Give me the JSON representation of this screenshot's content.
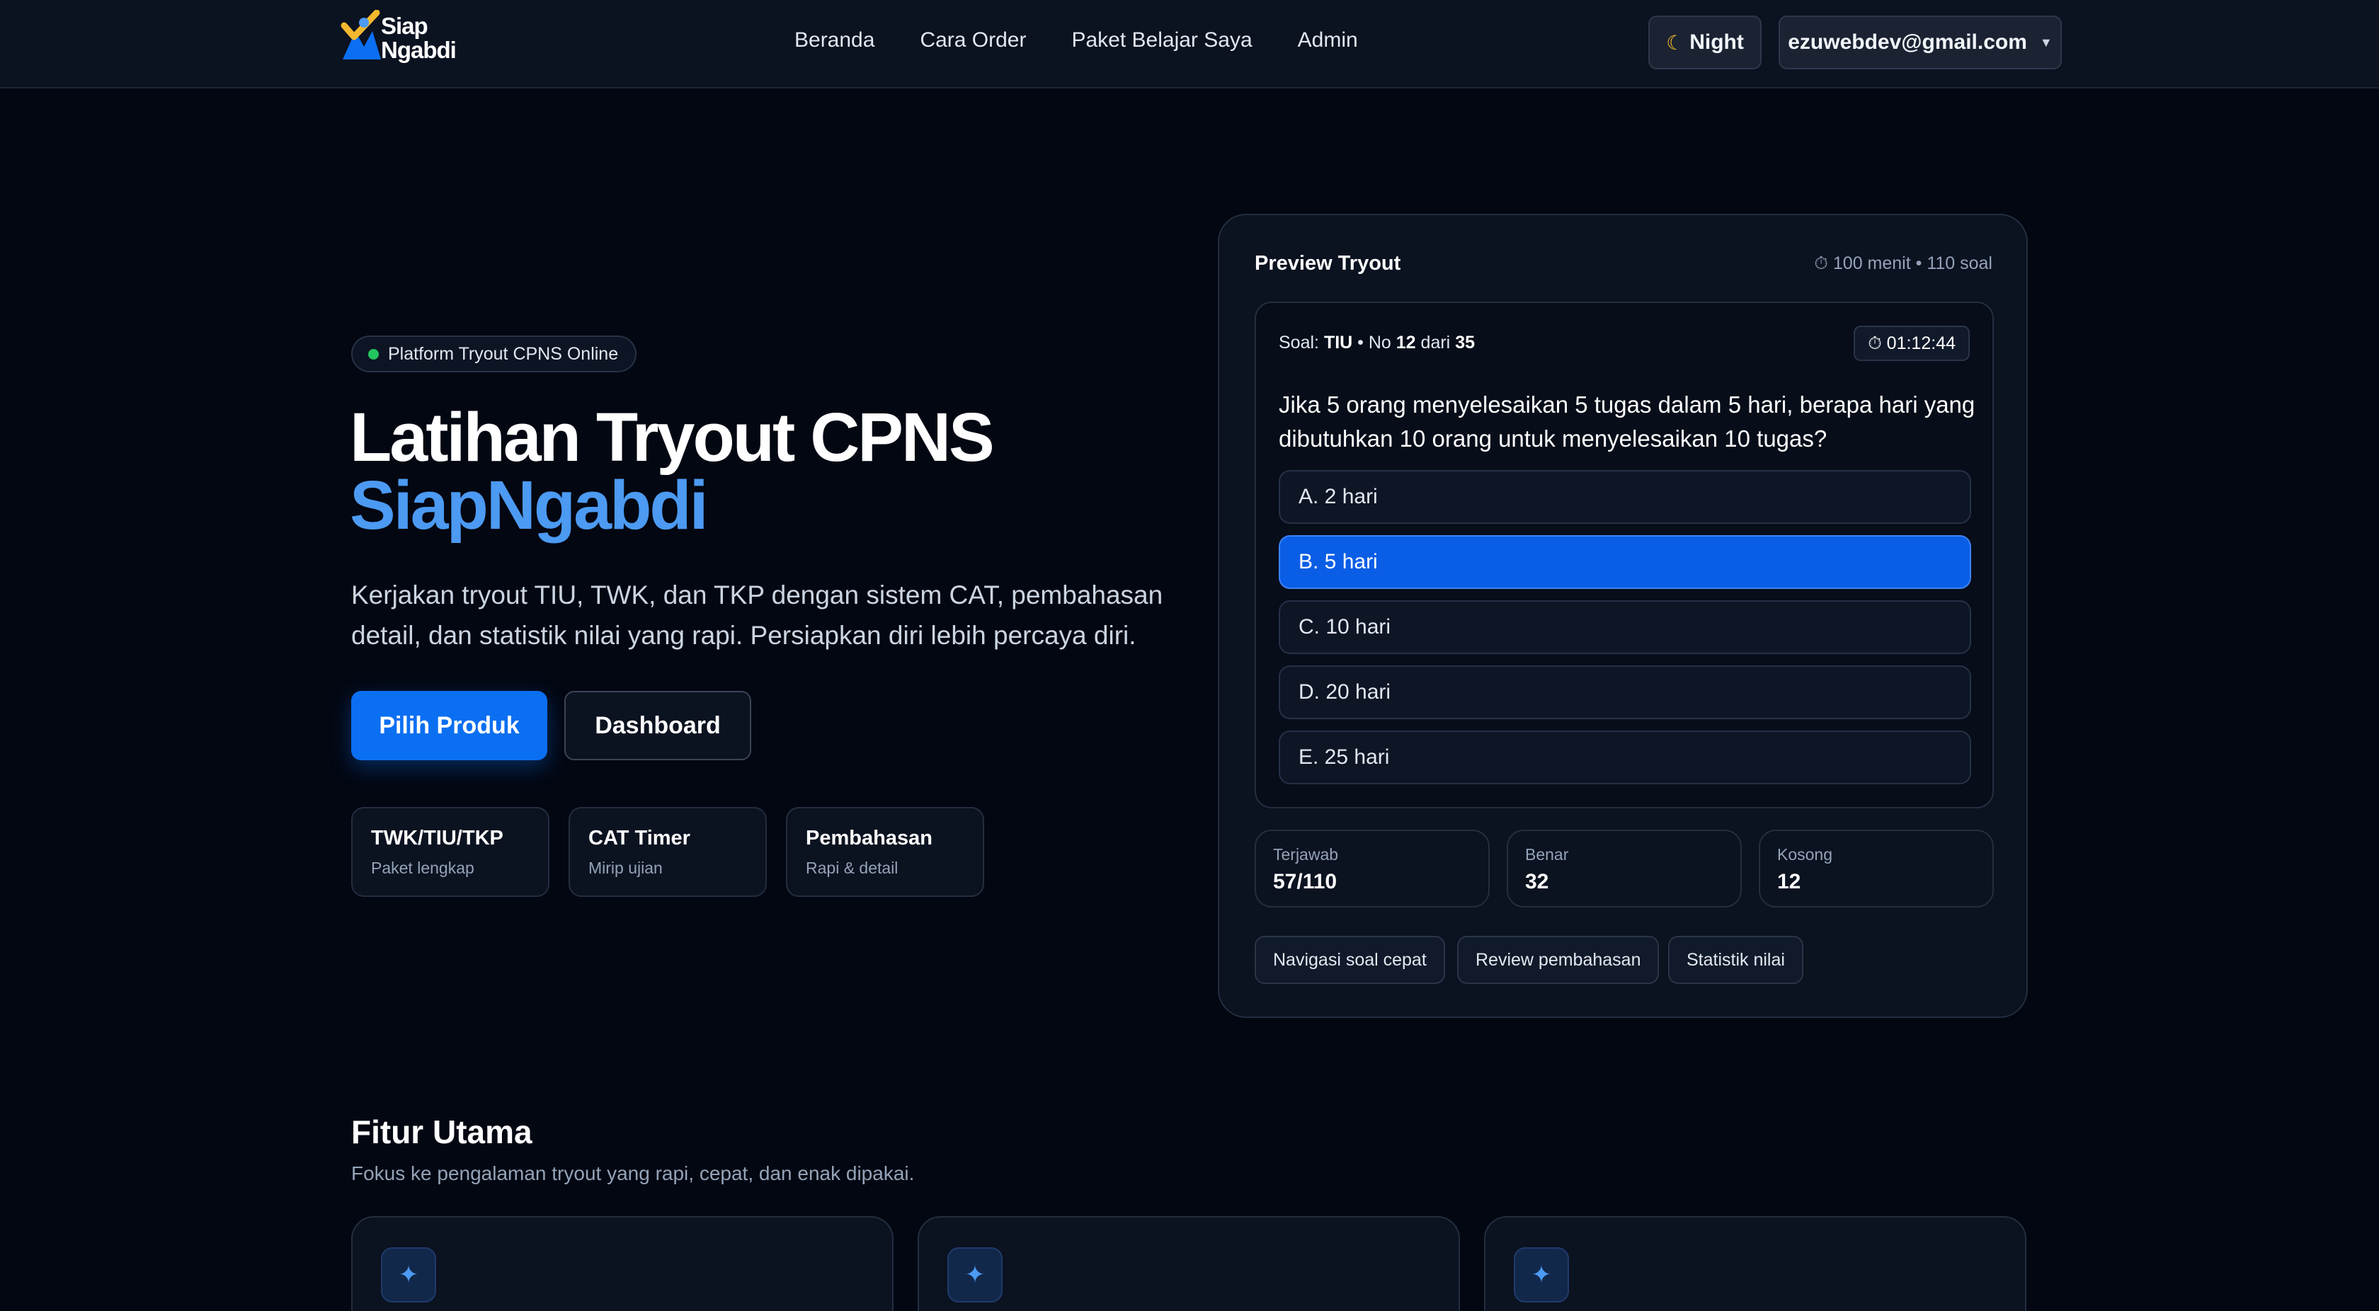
{
  "brand": {
    "line1": "Siap",
    "line2": "Ngabdi"
  },
  "nav": {
    "links": [
      "Beranda",
      "Cara Order",
      "Paket Belajar Saya",
      "Admin"
    ]
  },
  "header": {
    "theme_label": "Night",
    "user_email": "ezuwebdev@gmail.com"
  },
  "hero": {
    "badge": "Platform Tryout CPNS Online",
    "title_line1": "Latihan Tryout CPNS",
    "title_line2": "SiapNgabdi",
    "description": "Kerjakan tryout TIU, TWK, dan TKP dengan sistem CAT, pembahasan detail, dan statistik nilai yang rapi. Persiapkan diri lebih percaya diri.",
    "primary_button": "Pilih Produk",
    "secondary_button": "Dashboard",
    "mini_cards": [
      {
        "title": "TWK/TIU/TKP",
        "sub": "Paket lengkap"
      },
      {
        "title": "CAT Timer",
        "sub": "Mirip ujian"
      },
      {
        "title": "Pembahasan",
        "sub": "Rapi & detail"
      }
    ]
  },
  "preview": {
    "title": "Preview Tryout",
    "meta": "100 menit • 110 soal",
    "question": {
      "label_soal": "Soal:",
      "subject": "TIU",
      "label_no": "• No",
      "number": "12",
      "label_dari": "dari",
      "total": "35",
      "timer": "01:12:44",
      "text": "Jika 5 orang menyelesaikan 5 tugas dalam 5 hari, berapa hari yang dibutuhkan 10 orang untuk menyelesaikan 10 tugas?",
      "options": [
        "A. 2 hari",
        "B. 5 hari",
        "C. 10 hari",
        "D. 20 hari",
        "E. 25 hari"
      ],
      "selected_option": "B. 5 hari"
    },
    "stats": [
      {
        "label": "Terjawab",
        "value": "57/110"
      },
      {
        "label": "Benar",
        "value": "32"
      },
      {
        "label": "Kosong",
        "value": "12"
      }
    ],
    "chips": [
      "Navigasi soal cepat",
      "Review pembahasan",
      "Statistik nilai"
    ]
  },
  "features": {
    "title": "Fitur Utama",
    "subtitle": "Fokus ke pengalaman tryout yang rapi, cepat, dan enak dipakai."
  },
  "colors": {
    "accent": "#0b6ff2",
    "accent_text": "#4c9af2",
    "background": "#030712",
    "badge_dot": "#22c55e"
  },
  "icons": {
    "theme": "moon-icon",
    "timer": "stopwatch-icon",
    "feature": "sparkle-icon",
    "dropdown": "caret-down-icon"
  }
}
